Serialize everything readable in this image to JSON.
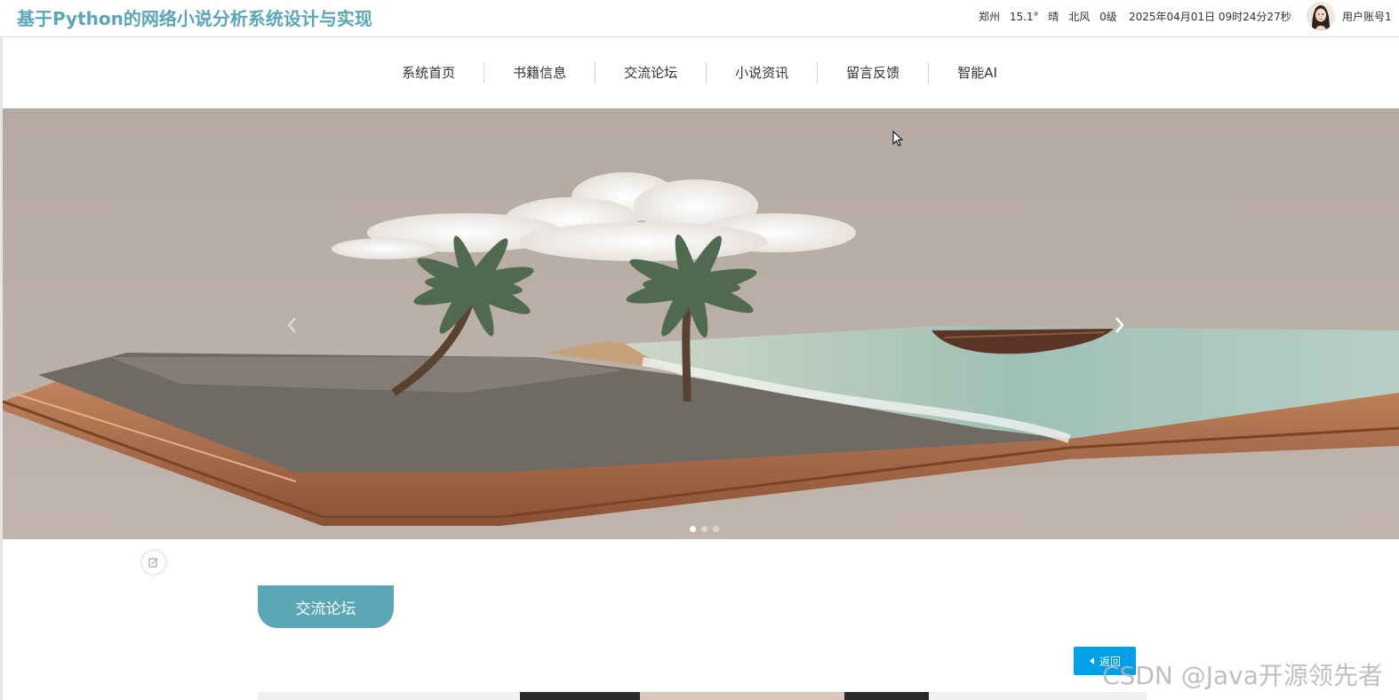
{
  "header": {
    "title": "基于Python的网络小说分析系统设计与实现",
    "weather": {
      "city": "郑州",
      "temperature": "15.1°",
      "condition": "晴",
      "wind": "北风",
      "level": "0级"
    },
    "datetime": "2025年04月01日 09时24分27秒",
    "username": "用户账号1"
  },
  "nav": {
    "items": [
      {
        "label": "系统首页"
      },
      {
        "label": "书籍信息"
      },
      {
        "label": "交流论坛"
      },
      {
        "label": "小说资讯"
      },
      {
        "label": "留言反馈"
      },
      {
        "label": "智能AI"
      }
    ]
  },
  "carousel": {
    "slide_count": 3,
    "active_index": 0,
    "prev_icon": "chevron-left-icon",
    "next_icon": "chevron-right-icon"
  },
  "section": {
    "tab_label": "交流论坛"
  },
  "actions": {
    "back_label": "返回"
  },
  "watermark": "CSDN @Java开源领先者",
  "colors": {
    "brand": "#5aa7b6",
    "back_button": "#00a0e9"
  }
}
